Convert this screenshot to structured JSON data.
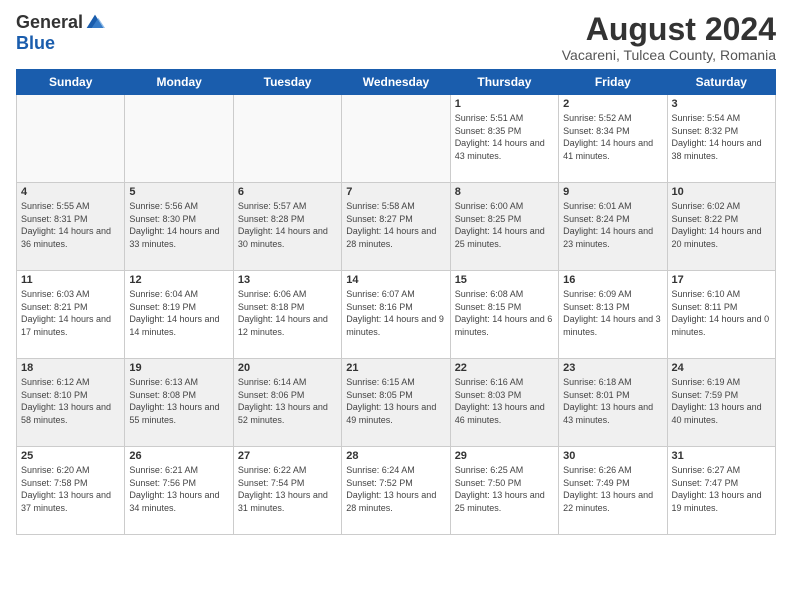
{
  "header": {
    "logo": {
      "general": "General",
      "blue": "Blue"
    },
    "title": "August 2024",
    "location": "Vacareni, Tulcea County, Romania"
  },
  "days": [
    "Sunday",
    "Monday",
    "Tuesday",
    "Wednesday",
    "Thursday",
    "Friday",
    "Saturday"
  ],
  "weeks": [
    [
      {
        "date": "",
        "info": ""
      },
      {
        "date": "",
        "info": ""
      },
      {
        "date": "",
        "info": ""
      },
      {
        "date": "",
        "info": ""
      },
      {
        "date": "1",
        "info": "Sunrise: 5:51 AM\nSunset: 8:35 PM\nDaylight: 14 hours\nand 43 minutes."
      },
      {
        "date": "2",
        "info": "Sunrise: 5:52 AM\nSunset: 8:34 PM\nDaylight: 14 hours\nand 41 minutes."
      },
      {
        "date": "3",
        "info": "Sunrise: 5:54 AM\nSunset: 8:32 PM\nDaylight: 14 hours\nand 38 minutes."
      }
    ],
    [
      {
        "date": "4",
        "info": "Sunrise: 5:55 AM\nSunset: 8:31 PM\nDaylight: 14 hours\nand 36 minutes."
      },
      {
        "date": "5",
        "info": "Sunrise: 5:56 AM\nSunset: 8:30 PM\nDaylight: 14 hours\nand 33 minutes."
      },
      {
        "date": "6",
        "info": "Sunrise: 5:57 AM\nSunset: 8:28 PM\nDaylight: 14 hours\nand 30 minutes."
      },
      {
        "date": "7",
        "info": "Sunrise: 5:58 AM\nSunset: 8:27 PM\nDaylight: 14 hours\nand 28 minutes."
      },
      {
        "date": "8",
        "info": "Sunrise: 6:00 AM\nSunset: 8:25 PM\nDaylight: 14 hours\nand 25 minutes."
      },
      {
        "date": "9",
        "info": "Sunrise: 6:01 AM\nSunset: 8:24 PM\nDaylight: 14 hours\nand 23 minutes."
      },
      {
        "date": "10",
        "info": "Sunrise: 6:02 AM\nSunset: 8:22 PM\nDaylight: 14 hours\nand 20 minutes."
      }
    ],
    [
      {
        "date": "11",
        "info": "Sunrise: 6:03 AM\nSunset: 8:21 PM\nDaylight: 14 hours\nand 17 minutes."
      },
      {
        "date": "12",
        "info": "Sunrise: 6:04 AM\nSunset: 8:19 PM\nDaylight: 14 hours\nand 14 minutes."
      },
      {
        "date": "13",
        "info": "Sunrise: 6:06 AM\nSunset: 8:18 PM\nDaylight: 14 hours\nand 12 minutes."
      },
      {
        "date": "14",
        "info": "Sunrise: 6:07 AM\nSunset: 8:16 PM\nDaylight: 14 hours\nand 9 minutes."
      },
      {
        "date": "15",
        "info": "Sunrise: 6:08 AM\nSunset: 8:15 PM\nDaylight: 14 hours\nand 6 minutes."
      },
      {
        "date": "16",
        "info": "Sunrise: 6:09 AM\nSunset: 8:13 PM\nDaylight: 14 hours\nand 3 minutes."
      },
      {
        "date": "17",
        "info": "Sunrise: 6:10 AM\nSunset: 8:11 PM\nDaylight: 14 hours\nand 0 minutes."
      }
    ],
    [
      {
        "date": "18",
        "info": "Sunrise: 6:12 AM\nSunset: 8:10 PM\nDaylight: 13 hours\nand 58 minutes."
      },
      {
        "date": "19",
        "info": "Sunrise: 6:13 AM\nSunset: 8:08 PM\nDaylight: 13 hours\nand 55 minutes."
      },
      {
        "date": "20",
        "info": "Sunrise: 6:14 AM\nSunset: 8:06 PM\nDaylight: 13 hours\nand 52 minutes."
      },
      {
        "date": "21",
        "info": "Sunrise: 6:15 AM\nSunset: 8:05 PM\nDaylight: 13 hours\nand 49 minutes."
      },
      {
        "date": "22",
        "info": "Sunrise: 6:16 AM\nSunset: 8:03 PM\nDaylight: 13 hours\nand 46 minutes."
      },
      {
        "date": "23",
        "info": "Sunrise: 6:18 AM\nSunset: 8:01 PM\nDaylight: 13 hours\nand 43 minutes."
      },
      {
        "date": "24",
        "info": "Sunrise: 6:19 AM\nSunset: 7:59 PM\nDaylight: 13 hours\nand 40 minutes."
      }
    ],
    [
      {
        "date": "25",
        "info": "Sunrise: 6:20 AM\nSunset: 7:58 PM\nDaylight: 13 hours\nand 37 minutes."
      },
      {
        "date": "26",
        "info": "Sunrise: 6:21 AM\nSunset: 7:56 PM\nDaylight: 13 hours\nand 34 minutes."
      },
      {
        "date": "27",
        "info": "Sunrise: 6:22 AM\nSunset: 7:54 PM\nDaylight: 13 hours\nand 31 minutes."
      },
      {
        "date": "28",
        "info": "Sunrise: 6:24 AM\nSunset: 7:52 PM\nDaylight: 13 hours\nand 28 minutes."
      },
      {
        "date": "29",
        "info": "Sunrise: 6:25 AM\nSunset: 7:50 PM\nDaylight: 13 hours\nand 25 minutes."
      },
      {
        "date": "30",
        "info": "Sunrise: 6:26 AM\nSunset: 7:49 PM\nDaylight: 13 hours\nand 22 minutes."
      },
      {
        "date": "31",
        "info": "Sunrise: 6:27 AM\nSunset: 7:47 PM\nDaylight: 13 hours\nand 19 minutes."
      }
    ]
  ]
}
